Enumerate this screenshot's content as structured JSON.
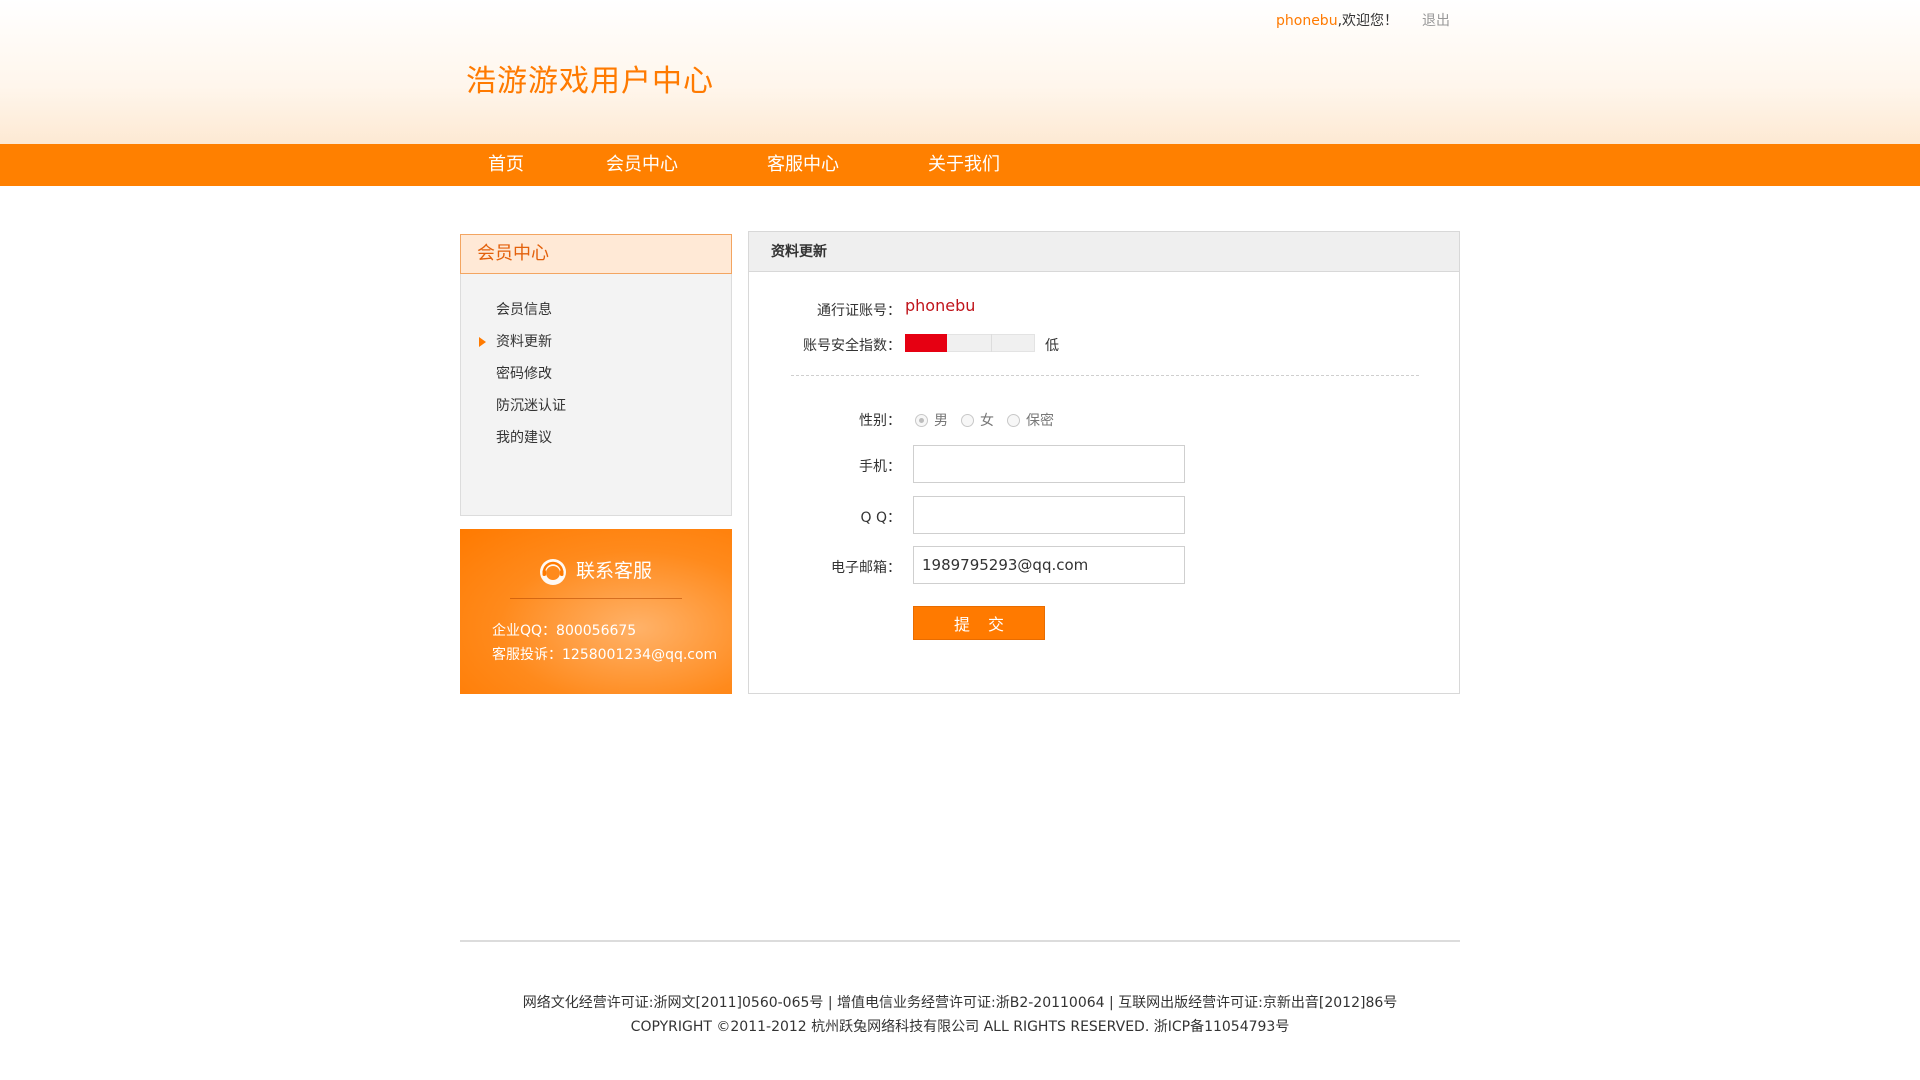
{
  "topbar": {
    "username": "phonebu",
    "welcome": ",欢迎您！",
    "logout": "退出"
  },
  "site": {
    "title": "浩游游戏用户中心"
  },
  "nav": {
    "items": [
      {
        "label": "首页"
      },
      {
        "label": "会员中心"
      },
      {
        "label": "客服中心"
      },
      {
        "label": "关于我们"
      }
    ]
  },
  "sidebar": {
    "title": "会员中心",
    "items": [
      {
        "label": "会员信息",
        "active": false
      },
      {
        "label": "资料更新",
        "active": true
      },
      {
        "label": "密码修改",
        "active": false
      },
      {
        "label": "防沉迷认证",
        "active": false
      },
      {
        "label": "我的建议",
        "active": false
      }
    ]
  },
  "contact": {
    "title": "联系客服",
    "icon": "headset-icon",
    "qq": "企业QQ：800056675",
    "complaint": "客服投诉：1258001234@qq.com"
  },
  "main": {
    "title": "资料更新",
    "account_label": "通行证账号：",
    "account_value": "phonebu",
    "security_label": "账号安全指数：",
    "security_level_text": "低",
    "security_level_fraction": 0.33,
    "security_color": "#e60012",
    "gender_label": "性别：",
    "gender_options": [
      "男",
      "女",
      "保密"
    ],
    "gender_selected": "男",
    "phone_label": "手机：",
    "phone_value": "",
    "qq_label": "Q Q：",
    "qq_value": "",
    "email_label": "电子邮箱：",
    "email_value": "1989795293@qq.com",
    "submit_label": "提交"
  },
  "footer": {
    "line1": "网络文化经营许可证:浙网文[2011]0560-065号 | 增值电信业务经营许可证:浙B2-20110064 | 互联网出版经营许可证:京新出音[2012]86号",
    "line2": "COPYRIGHT ©2011-2012 杭州跃兔网络科技有限公司 ALL RIGHTS RESERVED.  浙ICP备11054793号"
  },
  "colors": {
    "accent": "#ff8000",
    "title": "#ff7a00",
    "account": "#c0141b"
  }
}
